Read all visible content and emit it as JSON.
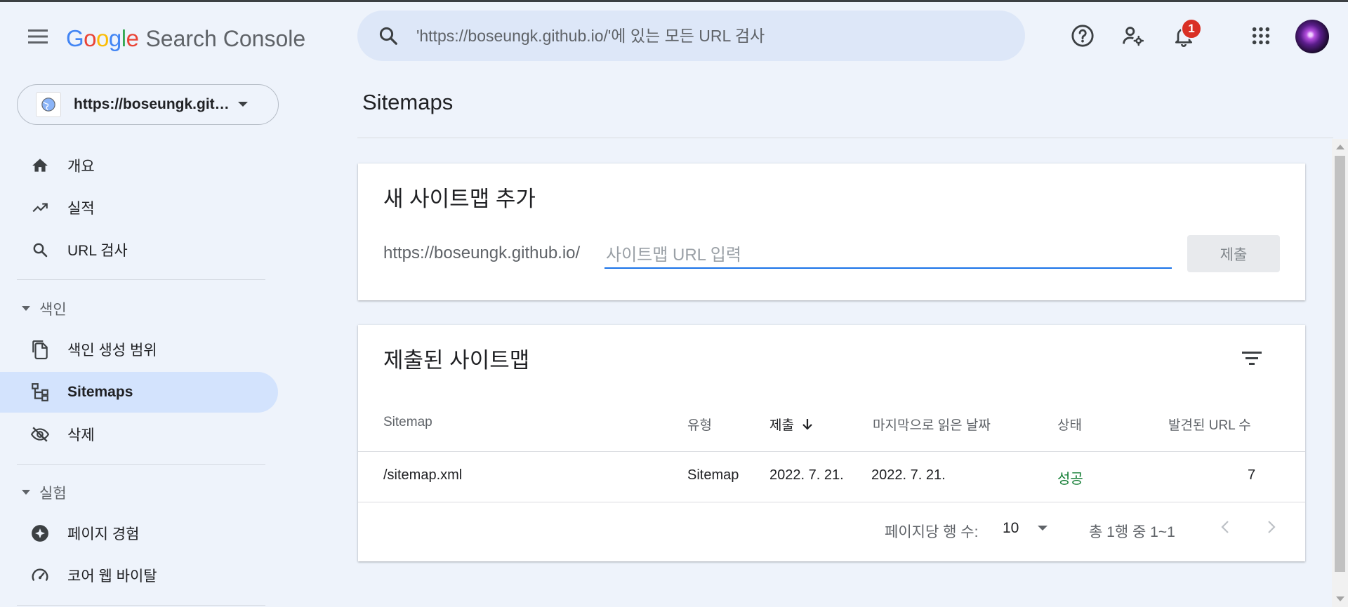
{
  "header": {
    "logo": {
      "letters": [
        "G",
        "o",
        "o",
        "g",
        "l",
        "e"
      ],
      "letter_colors": [
        "#4285f4",
        "#ea4335",
        "#fbbc05",
        "#4285f4",
        "#34a853",
        "#ea4335"
      ],
      "product": "Search Console"
    },
    "search_placeholder": "'https://boseungk.github.io/'에 있는 모든 URL 검사",
    "notification_count": "1",
    "icons": [
      "menu-icon",
      "search-icon",
      "help-icon",
      "manage-users-icon",
      "notifications-icon",
      "apps-grid-icon",
      "avatar"
    ]
  },
  "sidebar": {
    "property": "https://boseungk.github.io/",
    "items": [
      {
        "label": "개요",
        "icon": "home-icon"
      },
      {
        "label": "실적",
        "icon": "trending-up-icon"
      },
      {
        "label": "URL 검사",
        "icon": "search-icon"
      }
    ],
    "sections": [
      {
        "label": "색인",
        "items": [
          {
            "label": "색인 생성 범위",
            "icon": "copy-pages-icon"
          },
          {
            "label": "Sitemaps",
            "icon": "sitemap-icon",
            "active": true
          },
          {
            "label": "삭제",
            "icon": "visibility-off-icon"
          }
        ]
      },
      {
        "label": "실험",
        "items": [
          {
            "label": "페이지 경험",
            "icon": "page-experience-icon"
          },
          {
            "label": "코어 웹 바이탈",
            "icon": "speed-gauge-icon"
          }
        ]
      }
    ]
  },
  "main": {
    "title": "Sitemaps",
    "add_card": {
      "title": "새 사이트맵 추가",
      "prefix": "https://boseungk.github.io/",
      "placeholder": "사이트맵 URL 입력",
      "submit_label": "제출"
    },
    "submitted_card": {
      "title": "제출된 사이트맵",
      "columns": [
        "Sitemap",
        "유형",
        "제출",
        "마지막으로 읽은 날짜",
        "상태",
        "발견된 URL 수"
      ],
      "sorted_column": "제출",
      "rows": [
        {
          "sitemap": "/sitemap.xml",
          "type": "Sitemap",
          "submitted": "2022. 7. 21.",
          "last_read": "2022. 7. 21.",
          "status": "성공",
          "urls": "7"
        }
      ],
      "pagination": {
        "rows_per_page_label": "페이지당 행 수:",
        "rows_per_page": "10",
        "range": "총 1행 중 1~1"
      }
    }
  },
  "colors": {
    "accent": "#1a73e8",
    "active_nav": "#d3e3fd",
    "success": "#188038",
    "badge": "#d93025",
    "background": "#eef3fb"
  }
}
